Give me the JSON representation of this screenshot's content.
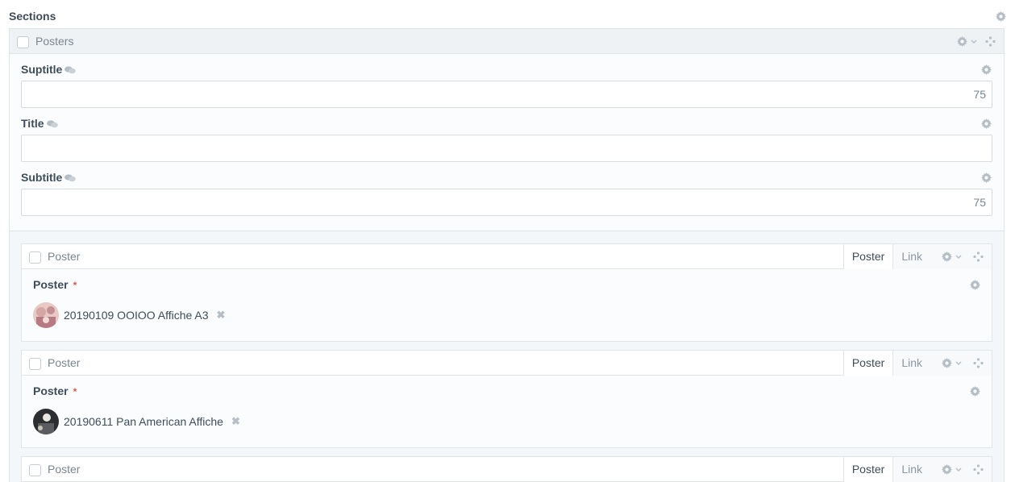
{
  "sections": {
    "title": "Sections"
  },
  "block": {
    "title": "Posters",
    "fields": [
      {
        "label": "Suptitle",
        "counter": "75",
        "value": ""
      },
      {
        "label": "Title",
        "counter": "",
        "value": ""
      },
      {
        "label": "Subtitle",
        "counter": "75",
        "value": ""
      }
    ]
  },
  "items": [
    {
      "title": "Poster",
      "tabs": [
        "Poster",
        "Link"
      ],
      "field_label": "Poster",
      "required_mark": "*",
      "asset_name": "20190109 OOIOO Affiche A3",
      "remove_glyph": "✖"
    },
    {
      "title": "Poster",
      "tabs": [
        "Poster",
        "Link"
      ],
      "field_label": "Poster",
      "required_mark": "*",
      "asset_name": "20190611 Pan American Affiche",
      "remove_glyph": "✖"
    },
    {
      "title": "Poster",
      "tabs": [
        "Poster",
        "Link"
      ]
    }
  ],
  "colors": {
    "accent_required": "#e0544b",
    "text": "#3f4d5a",
    "muted": "#7a8691",
    "border": "#e0e5e9"
  },
  "icons": {
    "settings": "gear-icon",
    "move": "move-icon",
    "translatable": "chat-bubble-icon",
    "dropdown": "chevron-down-icon",
    "remove": "remove-icon"
  }
}
